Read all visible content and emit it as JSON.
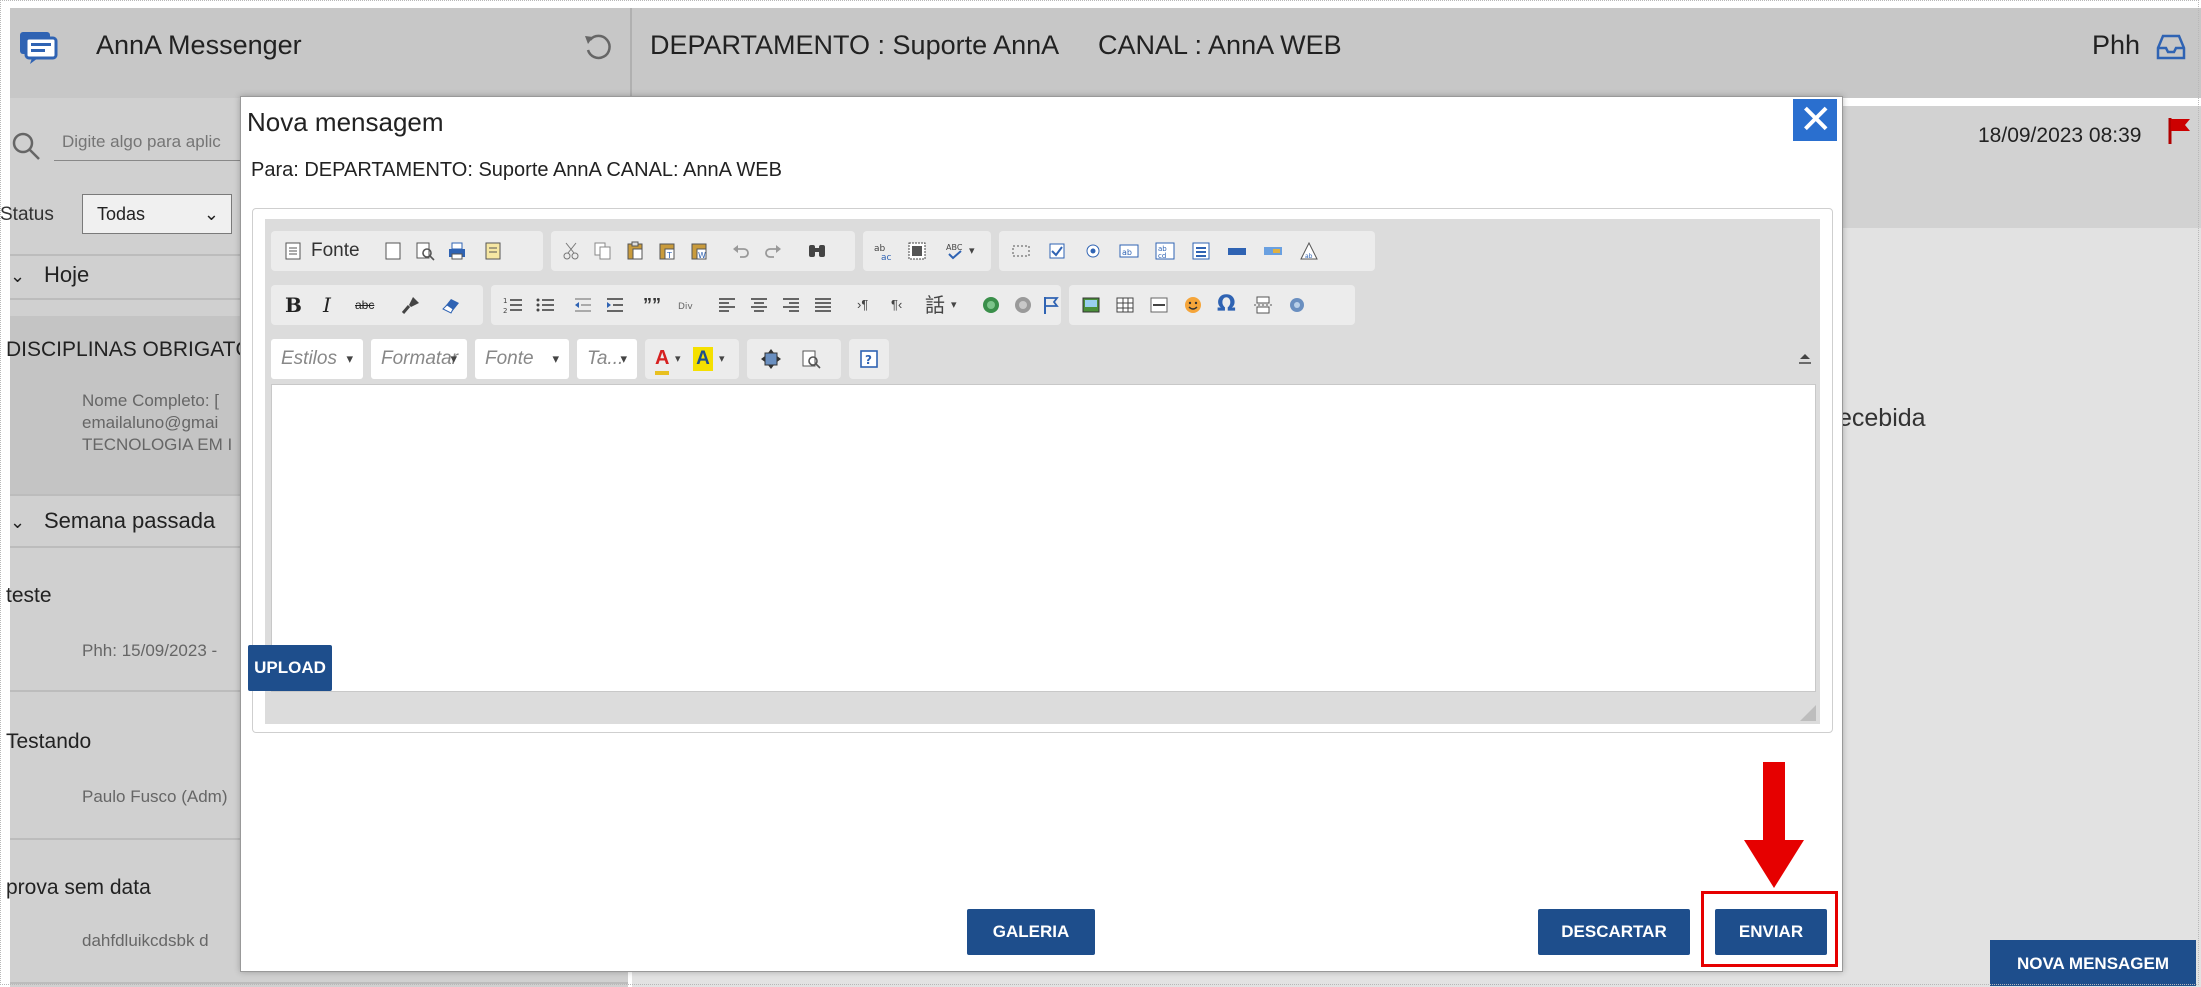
{
  "app": {
    "title": "AnnA Messenger"
  },
  "header": {
    "departamento": "DEPARTAMENTO : Suporte AnnA",
    "canal": "CANAL : AnnA WEB",
    "user": "Phh"
  },
  "sidebar": {
    "search_placeholder": "Digite algo para aplic",
    "status_label": "Status",
    "status_value": "Todas",
    "groups": [
      {
        "label": "Hoje"
      },
      {
        "label": "Semana passada"
      }
    ],
    "conversations": [
      {
        "title": "DISCIPLINAS OBRIGATÓ",
        "lines": [
          "Nome Completo: [",
          "emailaluno@gmai",
          "TECNOLOGIA EM I"
        ]
      },
      {
        "title": "teste",
        "lines": [
          "Phh: 15/09/2023 -"
        ]
      },
      {
        "title": "Testando",
        "lines": [
          "Paulo Fusco (Adm)"
        ]
      },
      {
        "title": "prova sem data",
        "lines": [
          "dahfdluikcdsbk d"
        ]
      }
    ]
  },
  "main": {
    "date": "18/09/2023 08:39",
    "received_text": "ecebida",
    "nova_mensagem_button": "NOVA MENSAGEM"
  },
  "modal": {
    "title": "Nova mensagem",
    "close_symbol": "✕",
    "para": "Para: DEPARTAMENTO: Suporte AnnA CANAL: AnnA WEB",
    "toolbar": {
      "fonte_button": "Fonte",
      "combos": [
        {
          "label": "Estilos"
        },
        {
          "label": "Formatar"
        },
        {
          "label": "Fonte"
        },
        {
          "label": "Ta..."
        }
      ]
    },
    "buttons": {
      "upload": "UPLOAD",
      "galeria": "GALERIA",
      "descartar": "DESCARTAR",
      "enviar": "ENVIAR"
    }
  },
  "colors": {
    "accent": "#1e4e8c",
    "close_button": "#2a6fcf",
    "highlight": "#e60000"
  }
}
